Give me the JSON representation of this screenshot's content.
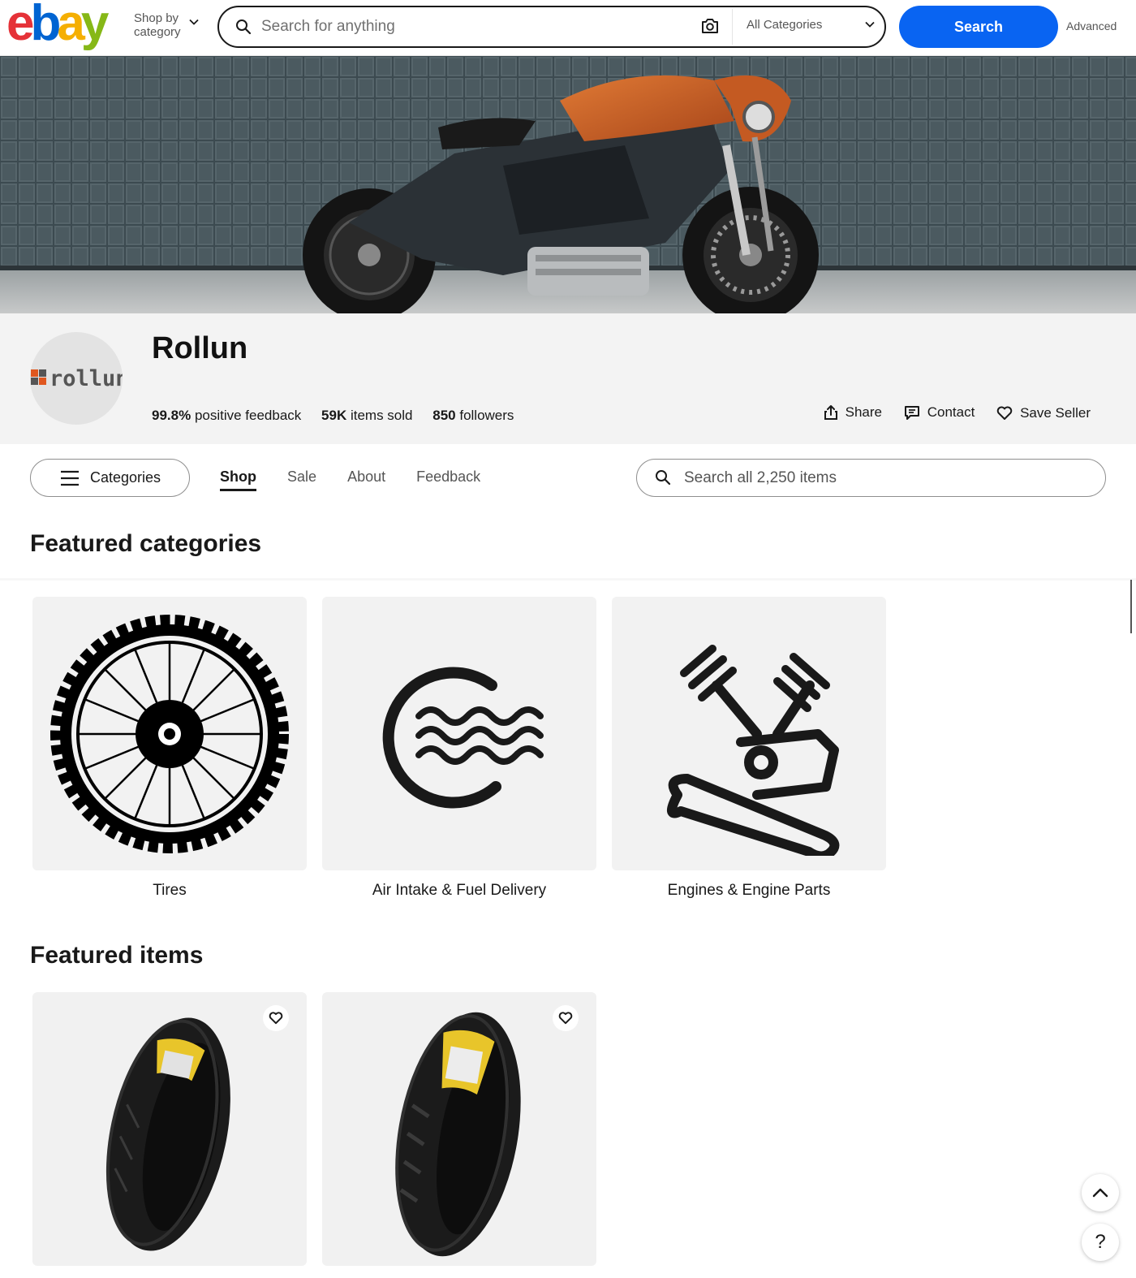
{
  "header": {
    "logo_letters": [
      "e",
      "b",
      "a",
      "y"
    ],
    "logo_colors": [
      "#e53238",
      "#0064d2",
      "#f5af02",
      "#86b817"
    ],
    "shop_by": "Shop by category",
    "search_placeholder": "Search for anything",
    "category_select": "All Categories",
    "search_button": "Search",
    "advanced": "Advanced",
    "accent": "#0964f2"
  },
  "seller": {
    "name": "Rollun",
    "logo_text": "rollun",
    "stats": [
      {
        "value": "99.8%",
        "label": "positive feedback"
      },
      {
        "value": "59K",
        "label": "items sold"
      },
      {
        "value": "850",
        "label": "followers"
      }
    ],
    "actions": [
      {
        "label": "Share",
        "icon": "share-icon"
      },
      {
        "label": "Contact",
        "icon": "contact-icon"
      },
      {
        "label": "Save Seller",
        "icon": "heart-icon"
      }
    ]
  },
  "nav": {
    "categories_button": "Categories",
    "tabs": [
      {
        "label": "Shop",
        "active": true
      },
      {
        "label": "Sale",
        "active": false
      },
      {
        "label": "About",
        "active": false
      },
      {
        "label": "Feedback",
        "active": false
      }
    ],
    "store_search_placeholder": "Search all 2,250 items"
  },
  "featured_categories": {
    "title": "Featured categories",
    "items": [
      {
        "label": "Tires",
        "icon": "wheel-icon"
      },
      {
        "label": "Air Intake & Fuel Delivery",
        "icon": "air-intake-icon"
      },
      {
        "label": "Engines & Engine Parts",
        "icon": "engine-wrench-icon"
      }
    ]
  },
  "featured_items": {
    "title": "Featured items",
    "items": [
      {
        "image": "motorcycle-tire-sport"
      },
      {
        "image": "motorcycle-tire-cruiser"
      }
    ]
  },
  "floating": {
    "help": "?"
  }
}
